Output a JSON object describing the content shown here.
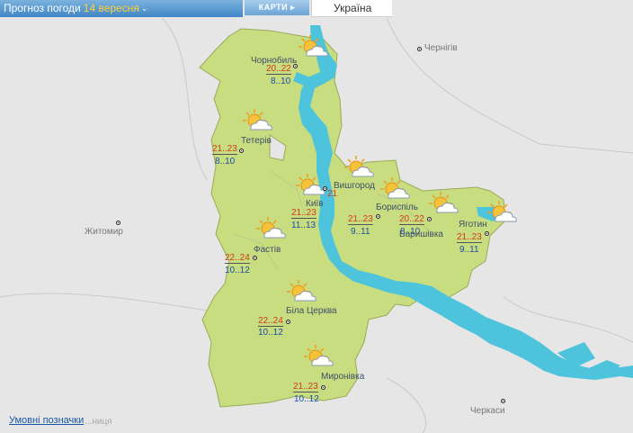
{
  "header": {
    "title": "Прогноз погоди",
    "date": "14 вересня",
    "caret": "⌄",
    "maps_button": "КАРТИ",
    "maps_arrow": "▸",
    "region": "Україна"
  },
  "external_cities": {
    "chernihiv": "Чернігів",
    "zhytomyr": "Житомир",
    "cherkasy": "Черкаси",
    "faded": "...ниця"
  },
  "forecast": [
    {
      "city": "Чорнобиль",
      "day": "20..22",
      "night": "8..10",
      "icon": "partly-cloudy-icon"
    },
    {
      "city": "Тетерів",
      "day": "21..23",
      "night": "8..10",
      "icon": "partly-cloudy-icon"
    },
    {
      "city": "Вишгород",
      "day": "21..23",
      "night": "9..11",
      "icon": "partly-cloudy-icon"
    },
    {
      "city": "Київ",
      "day": "21..23",
      "night": "11..13",
      "icon": "partly-cloudy-icon",
      "extra": "21"
    },
    {
      "city": "Бориспіль",
      "day": "21..23",
      "night": "9..11",
      "icon": "partly-cloudy-icon"
    },
    {
      "city": "Баришівка",
      "day": "20..22",
      "night": "8..10",
      "icon": "partly-cloudy-icon"
    },
    {
      "city": "Яготин",
      "day": "21..23",
      "night": "9..11",
      "icon": "partly-cloudy-icon"
    },
    {
      "city": "Фастів",
      "day": "22..24",
      "night": "10..12",
      "icon": "partly-cloudy-icon"
    },
    {
      "city": "Біла Церква",
      "day": "22..24",
      "night": "10..12",
      "icon": "partly-cloudy-icon"
    },
    {
      "city": "Миронівка",
      "day": "21..23",
      "night": "10..12",
      "icon": "partly-cloudy-icon"
    }
  ],
  "legend": "Умовні позначки",
  "colors": {
    "region": "#c8dc80",
    "water": "#4ec3dc",
    "land": "#e6e6e6",
    "day_temp": "#d23a1c",
    "night_temp": "#1c4fa6"
  }
}
